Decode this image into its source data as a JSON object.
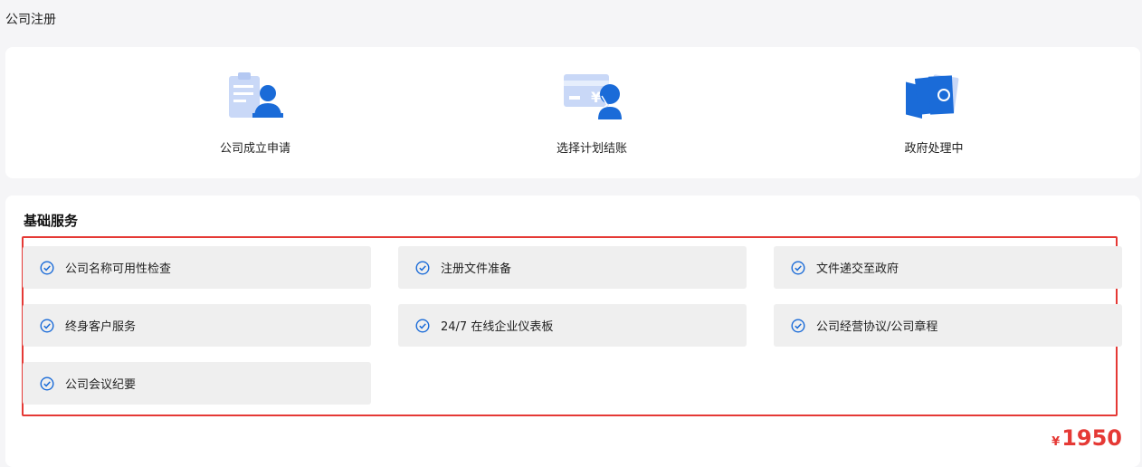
{
  "page": {
    "title": "公司注册"
  },
  "steps": [
    {
      "label": "公司成立申请",
      "icon": "application-form-icon"
    },
    {
      "label": "选择计划结账",
      "icon": "payment-card-icon"
    },
    {
      "label": "政府处理中",
      "icon": "documents-processing-icon"
    }
  ],
  "services": {
    "title": "基础服务",
    "items": [
      "公司名称可用性检查",
      "注册文件准备",
      "文件递交至政府",
      "终身客户服务",
      "24/7 在线企业仪表板",
      "公司经营协议/公司章程",
      "公司会议纪要"
    ],
    "check_icon": "check-circle-icon"
  },
  "price": {
    "symbol": "¥",
    "amount": "1950"
  },
  "colors": {
    "accent_blue": "#1a6bd8",
    "light_blue": "#c9d8f7",
    "highlight_red": "#e53935"
  }
}
